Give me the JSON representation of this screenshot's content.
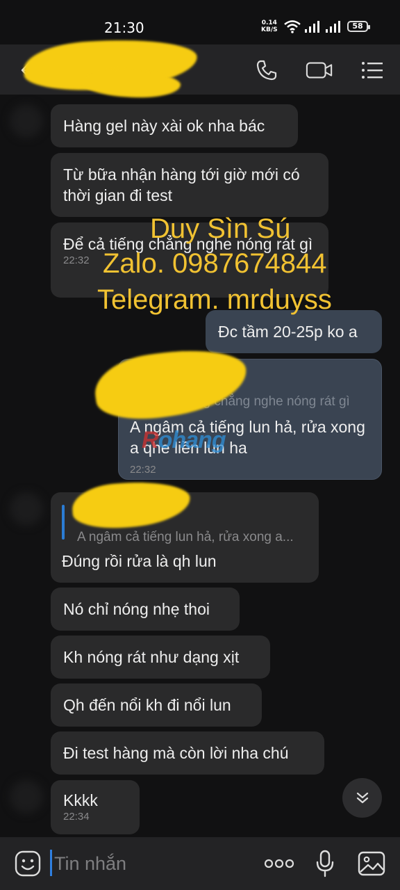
{
  "status_bar": {
    "time": "21:30",
    "net_speed_value": "0.14",
    "net_speed_unit": "KB/S",
    "battery": "58"
  },
  "header": {
    "icons": [
      "back-arrow-icon",
      "phone-icon",
      "video-call-icon",
      "menu-icon"
    ]
  },
  "messages": [
    {
      "id": "m1",
      "direction": "in",
      "text": "Hàng gel này xài ok nha bác"
    },
    {
      "id": "m2",
      "direction": "in",
      "text": "Từ bữa nhận hàng tới giờ mới có thời gian đi test"
    },
    {
      "id": "m3",
      "direction": "in",
      "text": "Để cả tiếng chẳng nghe nóng rát gì",
      "time": "22:32"
    },
    {
      "id": "m4",
      "direction": "out",
      "text": "Đc tầm 20-25p ko a"
    },
    {
      "id": "m5",
      "direction": "out",
      "quote": "Để cả tiếng chẳng nghe nóng rát gì",
      "text": "A ngâm cả tiếng lun hả, rửa xong a qhe liền lun ha",
      "time": "22:32"
    },
    {
      "id": "m6",
      "direction": "in",
      "quote": "A ngâm cả tiếng lun hả, rửa xong a...",
      "text": "Đúng rồi rửa là qh lun"
    },
    {
      "id": "m7",
      "direction": "in",
      "text": "Nó chỉ nóng nhẹ thoi"
    },
    {
      "id": "m8",
      "direction": "in",
      "text": "Kh nóng rát như dạng xịt"
    },
    {
      "id": "m9",
      "direction": "in",
      "text": "Qh đến nổi kh đi nổi lun"
    },
    {
      "id": "m10",
      "direction": "in",
      "text": "Đi test hàng mà còn lời nha chú"
    },
    {
      "id": "m11",
      "direction": "in",
      "text": "Kkkk",
      "time": "22:34"
    }
  ],
  "watermark": {
    "line1": "Duy Sìn Sú",
    "line2": "Zalo. 0987674844",
    "line3": "Telegram. mrduyss",
    "color": "#f1c232"
  },
  "logo_watermark": "Rohang",
  "input_bar": {
    "placeholder": "Tin nhắn",
    "icons": [
      "emoji-icon",
      "more-icon",
      "microphone-icon",
      "image-icon"
    ]
  },
  "colors": {
    "background": "#111112",
    "incoming_bubble": "#2a2a2b",
    "outgoing_bubble": "#3a4452",
    "accent": "#2b7cd4",
    "redaction": "#f6cc12"
  }
}
